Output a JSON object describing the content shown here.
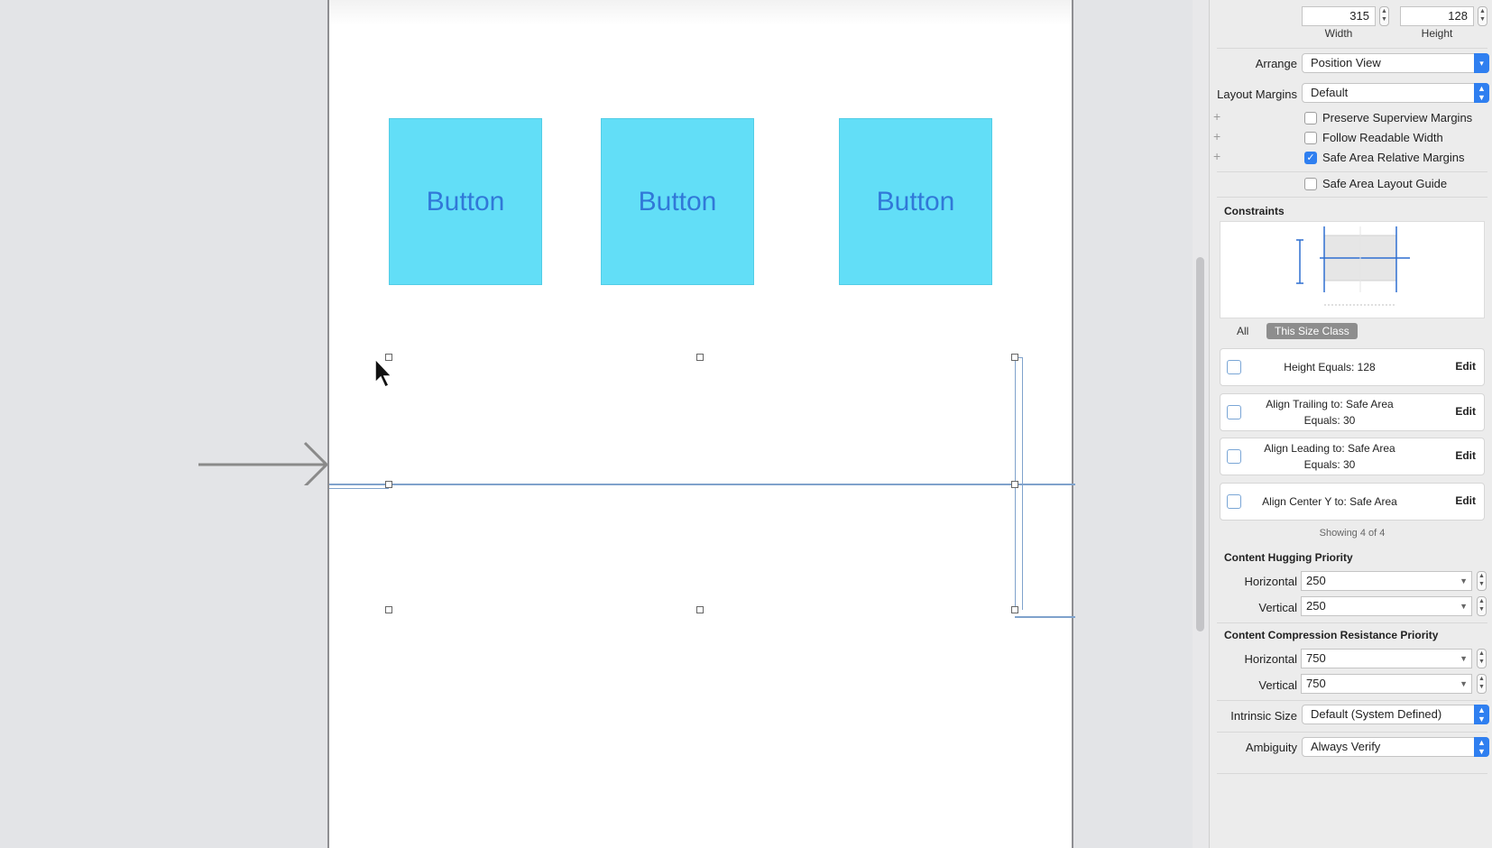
{
  "canvas": {
    "buttons": [
      "Button",
      "Button",
      "Button"
    ]
  },
  "size": {
    "width_value": "315",
    "height_value": "128",
    "width_caption": "Width",
    "height_caption": "Height"
  },
  "arrange": {
    "label": "Arrange",
    "value": "Position View"
  },
  "layout_margins": {
    "label": "Layout Margins",
    "value": "Default"
  },
  "checkboxes": [
    {
      "label": "Preserve Superview Margins",
      "checked": false
    },
    {
      "label": "Follow Readable Width",
      "checked": false
    },
    {
      "label": "Safe Area Relative Margins",
      "checked": true
    },
    {
      "label": "Safe Area Layout Guide",
      "checked": false
    }
  ],
  "constraints": {
    "title": "Constraints",
    "tabs": [
      "All",
      "This Size Class"
    ],
    "rows": [
      {
        "line1": "Height Equals:  128",
        "line2": "",
        "edit": "Edit"
      },
      {
        "line1": "Align Trailing to:  Safe Area",
        "line2": "Equals:  30",
        "edit": "Edit"
      },
      {
        "line1": "Align Leading to:  Safe Area",
        "line2": "Equals:  30",
        "edit": "Edit"
      },
      {
        "line1": "Align Center Y to:  Safe Area",
        "line2": "",
        "edit": "Edit"
      }
    ],
    "showing": "Showing 4 of 4"
  },
  "hugging": {
    "title": "Content Hugging Priority",
    "horizontal_label": "Horizontal",
    "horizontal_value": "250",
    "vertical_label": "Vertical",
    "vertical_value": "250"
  },
  "compression": {
    "title": "Content Compression Resistance Priority",
    "horizontal_label": "Horizontal",
    "horizontal_value": "750",
    "vertical_label": "Vertical",
    "vertical_value": "750"
  },
  "intrinsic_size": {
    "label": "Intrinsic Size",
    "value": "Default (System Defined)"
  },
  "ambiguity": {
    "label": "Ambiguity",
    "value": "Always Verify"
  },
  "colors": {
    "button_fill": "#62def7",
    "button_text": "#3178d8",
    "accent": "#2f7ff0",
    "guide": "#7fa2cc"
  }
}
